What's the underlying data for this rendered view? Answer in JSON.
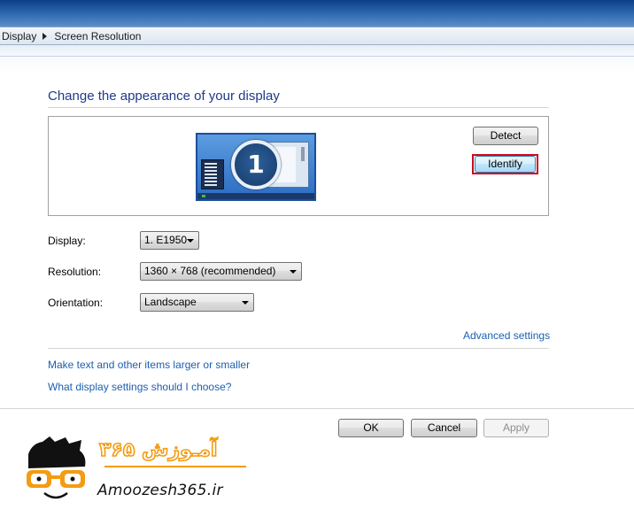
{
  "breadcrumb": {
    "items": [
      "Display",
      "Screen Resolution"
    ]
  },
  "heading": "Change the appearance of your display",
  "preview": {
    "monitor_number": "1"
  },
  "buttons": {
    "detect": "Detect",
    "identify": "Identify",
    "ok": "OK",
    "cancel": "Cancel",
    "apply": "Apply"
  },
  "fields": {
    "display": {
      "label": "Display:",
      "value": "1. E1950"
    },
    "resolution": {
      "label": "Resolution:",
      "value": "1360 × 768 (recommended)"
    },
    "orientation": {
      "label": "Orientation:",
      "value": "Landscape"
    }
  },
  "links": {
    "advanced": "Advanced settings",
    "text_size": "Make text and other items larger or smaller",
    "help": "What display settings should I choose?"
  },
  "watermark": {
    "text": "Amoozesh365.ir",
    "fa_text": "آمـوزش ۳۶۵"
  },
  "colors": {
    "link": "#1c5fb0",
    "heading": "#1e3a8a",
    "highlight": "#cc0a1e",
    "logo_accent": "#f39c12"
  }
}
